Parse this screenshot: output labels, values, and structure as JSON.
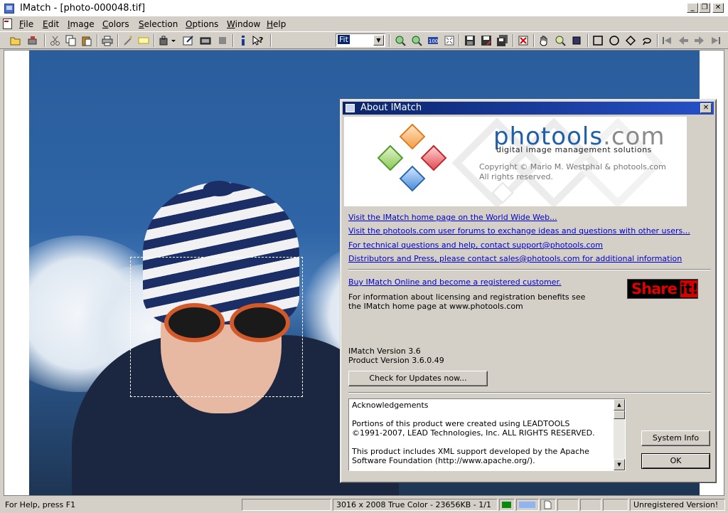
{
  "window": {
    "title": "IMatch - [photo-000048.tif]",
    "controls": {
      "minimize": "_",
      "restore": "❐",
      "close": "✕"
    }
  },
  "menu": [
    "File",
    "Edit",
    "Image",
    "Colors",
    "Selection",
    "Options",
    "Window",
    "Help"
  ],
  "toolbar": {
    "zoom_value": "Fit",
    "icons": [
      "open-icon",
      "scan-icon",
      "cut-icon",
      "copy-icon",
      "paste-icon",
      "print-icon",
      "wand-icon",
      "note-icon",
      "plugin-icon",
      "edit-icon",
      "slideshow-icon",
      "stop-icon",
      "info-icon",
      "help-icon",
      "zoom-in-icon",
      "zoom-out-icon",
      "zoom-100-icon",
      "zoom-fit-icon",
      "save-icon",
      "save-as-icon",
      "save-all-icon",
      "delete-icon",
      "hand-icon",
      "zoom-tool-icon",
      "crop-icon",
      "rect-select-icon",
      "ellipse-select-icon",
      "polygon-select-icon",
      "lasso-icon",
      "first-icon",
      "prev-icon",
      "next-icon",
      "last-icon"
    ]
  },
  "colors": {
    "title_gradient_start": "#0a246a",
    "title_gradient_end": "#2650c8",
    "link": "#0000cc",
    "brand_blue": "#1f5fa8",
    "shareit_red": "#e00000"
  },
  "dialog": {
    "title": "About IMatch",
    "close": "✕",
    "brand_main": "photools",
    "brand_dot": ".com",
    "tagline": "digital image management solutions",
    "copyright_line1": "Copyright © Mario M. Westphal & photools.com",
    "copyright_line2": "All rights reserved.",
    "links": [
      "Visit the IMatch home page on the World Wide Web...",
      "Visit the photools.com user forums to exchange ideas and questions with other users...",
      "For technical questions and help, contact support@photools.com",
      "Distributors and Press, please contact sales@photools.com for additional information"
    ],
    "buy_link": "Buy IMatch Online and become a registered customer.",
    "license_line1": "For information about licensing and registration benefits see",
    "license_line2": "the IMatch home page at www.photools.com",
    "shareit_word": "Share",
    "shareit_mark": "it!",
    "version": "IMatch Version 3.6",
    "product_version": "Product Version 3.6.0.49",
    "check_updates": "Check for Updates now...",
    "ack_title": "Acknowledgements",
    "ack_p1_line1": "Portions of this product were created using LEADTOOLS",
    "ack_p1_line2": "©1991-2007, LEAD Technologies, Inc. ALL RIGHTS RESERVED.",
    "ack_p2_line1": "This product includes XML support developed by the Apache",
    "ack_p2_line2": "Software Foundation (http://www.apache.org/).",
    "system_info": "System Info",
    "ok": "OK"
  },
  "status": {
    "help": "For Help, press F1",
    "image_info": "3016 x 2008 True Color - 23656KB - 1/1",
    "registration": "Unregistered Version!"
  }
}
